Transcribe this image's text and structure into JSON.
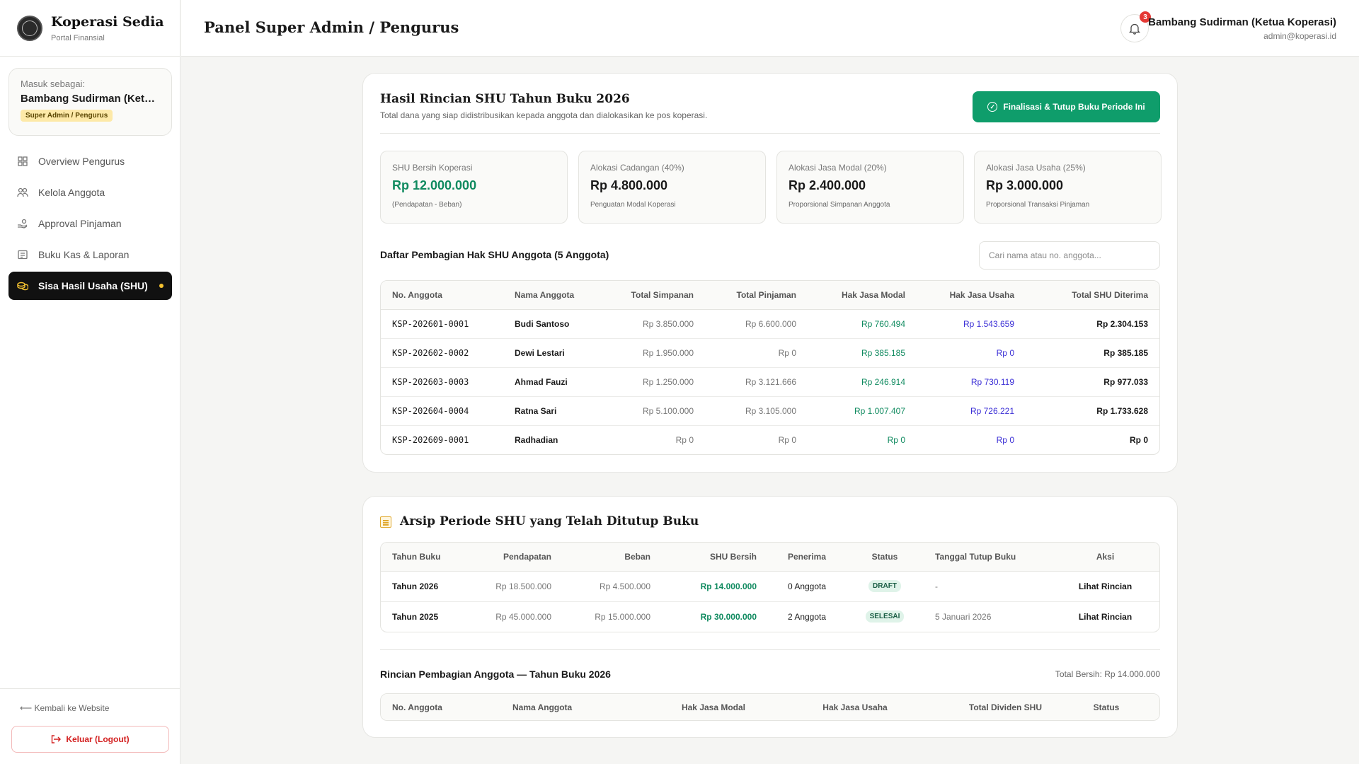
{
  "brand": {
    "name": "Koperasi Sedia",
    "subtitle": "Portal Finansial"
  },
  "login": {
    "label": "Masuk sebagai:",
    "name": "Bambang Sudirman (Ketua...",
    "role": "Super Admin / Pengurus"
  },
  "nav": [
    {
      "label": "Overview Pengurus",
      "icon": "grid-icon"
    },
    {
      "label": "Kelola Anggota",
      "icon": "users-icon"
    },
    {
      "label": "Approval Pinjaman",
      "icon": "hand-coins-icon"
    },
    {
      "label": "Buku Kas & Laporan",
      "icon": "ledger-icon"
    },
    {
      "label": "Sisa Hasil Usaha (SHU)",
      "icon": "coins-icon",
      "active": true
    }
  ],
  "sidebar_footer": {
    "back": "⟵ Kembali ke Website",
    "logout": "Keluar (Logout)"
  },
  "header": {
    "title": "Panel Super Admin / Pengurus",
    "notif_count": "3",
    "user_name": "Bambang Sudirman (Ketua Koperasi)",
    "user_email": "admin@koperasi.id"
  },
  "shu": {
    "title": "Hasil Rincian SHU Tahun Buku 2026",
    "subtitle": "Total dana yang siap didistribusikan kepada anggota dan dialokasikan ke pos koperasi.",
    "finalize_label": "Finalisasi & Tutup Buku Periode Ini",
    "stats": [
      {
        "label": "SHU Bersih Koperasi",
        "value": "Rp 12.000.000",
        "note": "(Pendapatan - Beban)",
        "accent": "#0f8a5f"
      },
      {
        "label": "Alokasi Cadangan (40%)",
        "value": "Rp 4.800.000",
        "note": "Penguatan Modal Koperasi",
        "accent": "#111111"
      },
      {
        "label": "Alokasi Jasa Modal (20%)",
        "value": "Rp 2.400.000",
        "note": "Proporsional Simpanan Anggota",
        "accent": "#111111"
      },
      {
        "label": "Alokasi Jasa Usaha (25%)",
        "value": "Rp 3.000.000",
        "note": "Proporsional Transaksi Pinjaman",
        "accent": "#111111"
      }
    ],
    "list_title": "Daftar Pembagian Hak SHU Anggota (5 Anggota)",
    "search_placeholder": "Cari nama atau no. anggota...",
    "columns": [
      "No. Anggota",
      "Nama Anggota",
      "Total Simpanan",
      "Total Pinjaman",
      "Hak Jasa Modal",
      "Hak Jasa Usaha",
      "Total SHU Diterima"
    ],
    "rows": [
      [
        "KSP-202601-0001",
        "Budi Santoso",
        "Rp 3.850.000",
        "Rp 6.600.000",
        "Rp 760.494",
        "Rp 1.543.659",
        "Rp 2.304.153"
      ],
      [
        "KSP-202602-0002",
        "Dewi Lestari",
        "Rp 1.950.000",
        "Rp 0",
        "Rp 385.185",
        "Rp 0",
        "Rp 385.185"
      ],
      [
        "KSP-202603-0003",
        "Ahmad Fauzi",
        "Rp 1.250.000",
        "Rp 3.121.666",
        "Rp 246.914",
        "Rp 730.119",
        "Rp 977.033"
      ],
      [
        "KSP-202604-0004",
        "Ratna Sari",
        "Rp 5.100.000",
        "Rp 3.105.000",
        "Rp 1.007.407",
        "Rp 726.221",
        "Rp 1.733.628"
      ],
      [
        "KSP-202609-0001",
        "Radhadian",
        "Rp 0",
        "Rp 0",
        "Rp 0",
        "Rp 0",
        "Rp 0"
      ]
    ]
  },
  "archive": {
    "title": "Arsip Periode SHU yang Telah Ditutup Buku",
    "columns": [
      "Tahun Buku",
      "Pendapatan",
      "Beban",
      "SHU Bersih",
      "Penerima",
      "Status",
      "Tanggal Tutup Buku",
      "Aksi"
    ],
    "rows": [
      [
        "Tahun 2026",
        "Rp 18.500.000",
        "Rp 4.500.000",
        "Rp 14.000.000",
        "0 Anggota",
        "DRAFT",
        "-",
        "Lihat Rincian"
      ],
      [
        "Tahun 2025",
        "Rp 45.000.000",
        "Rp 15.000.000",
        "Rp 30.000.000",
        "2 Anggota",
        "SELESAI",
        "5 Januari 2026",
        "Lihat Rincian"
      ]
    ],
    "detail_title": "Rincian Pembagian Anggota — Tahun Buku 2026",
    "detail_total": "Total Bersih: Rp 14.000.000",
    "detail_columns": [
      "No. Anggota",
      "Nama Anggota",
      "Hak Jasa Modal",
      "Hak Jasa Usaha",
      "Total Dividen SHU",
      "Status"
    ]
  }
}
